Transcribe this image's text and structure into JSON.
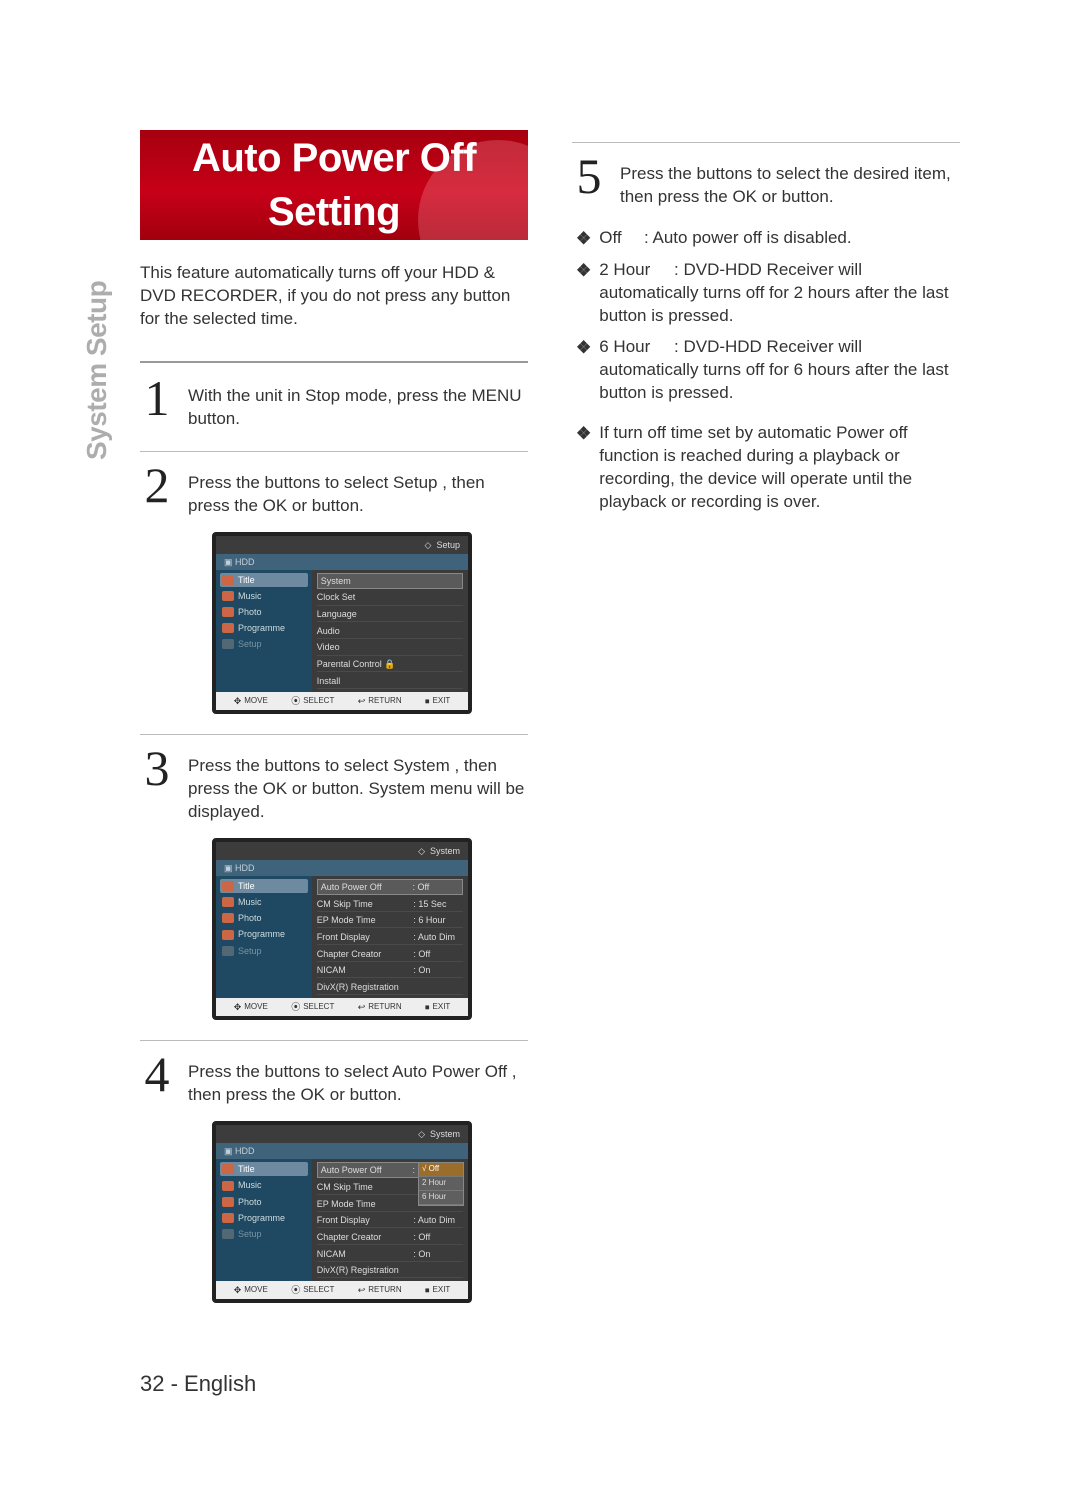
{
  "side_tab": "System Setup",
  "banner_title": "Auto Power Off Setting",
  "intro": "This feature automatically turns off your HDD & DVD RECORDER, if you do not press any button for the selected time.",
  "steps": {
    "s1": {
      "num": "1",
      "text": "With the unit in Stop mode, press the MENU button."
    },
    "s2": {
      "num": "2",
      "text": "Press the          buttons to select Setup , then press the OK or          button."
    },
    "s3": {
      "num": "3",
      "text": "Press the          buttons to select System , then press the OK or          button. System menu will be displayed."
    },
    "s4": {
      "num": "4",
      "text": "Press the          buttons to select Auto Power Off , then press the OK or          button."
    },
    "s5": {
      "num": "5",
      "text": "Press the          buttons to select the desired item, then press the OK or          button."
    }
  },
  "options": {
    "off": {
      "term": "Off",
      "sep": ":",
      "desc": "Auto power off is disabled."
    },
    "h2": {
      "term": "2 Hour",
      "sep": ":",
      "desc": "DVD-HDD Receiver will automatically turns off for 2 hours after the last button is pressed."
    },
    "h6": {
      "term": "6 Hour",
      "sep": ":",
      "desc": "DVD-HDD Receiver will automatically turns off for 6 hours after the last button is pressed."
    },
    "note": {
      "desc": "If turn off time set by automatic Power off function is reached during a playback or recording, the device will operate until the playback or recording is over."
    }
  },
  "bullet_mark": "❖",
  "shot_common": {
    "hdd": "HDD",
    "side": [
      "Title",
      "Music",
      "Photo",
      "Programme",
      "Setup"
    ],
    "footer": {
      "move": "MOVE",
      "select": "SELECT",
      "return": "RETURN",
      "exit": "EXIT"
    }
  },
  "shot1": {
    "crumb": "Setup",
    "items": [
      "System",
      "Clock Set",
      "Language",
      "Audio",
      "Video",
      "Parental Control   🔒",
      "Install"
    ]
  },
  "shot2": {
    "crumb": "System",
    "rows": [
      {
        "l": "Auto Power Off",
        "v": ": Off",
        "hl": true
      },
      {
        "l": "CM Skip Time",
        "v": ": 15 Sec"
      },
      {
        "l": "EP Mode Time",
        "v": ": 6 Hour"
      },
      {
        "l": "Front Display",
        "v": ": Auto Dim"
      },
      {
        "l": "Chapter Creator",
        "v": ": Off"
      },
      {
        "l": "NICAM",
        "v": ": On"
      },
      {
        "l": "DivX(R) Registration",
        "v": ""
      }
    ]
  },
  "shot3": {
    "crumb": "System",
    "rows": [
      {
        "l": "Auto Power Off",
        "v": ""
      },
      {
        "l": "CM Skip Time",
        "v": ""
      },
      {
        "l": "EP Mode Time",
        "v": ""
      },
      {
        "l": "Front Display",
        "v": ": Auto Dim"
      },
      {
        "l": "Chapter Creator",
        "v": ": Off"
      },
      {
        "l": "NICAM",
        "v": ": On"
      },
      {
        "l": "DivX(R) Registration",
        "v": ""
      }
    ],
    "opts": [
      "Off",
      "2 Hour",
      "6 Hour"
    ],
    "opt_sel": 0
  },
  "page_number": "32 - English"
}
